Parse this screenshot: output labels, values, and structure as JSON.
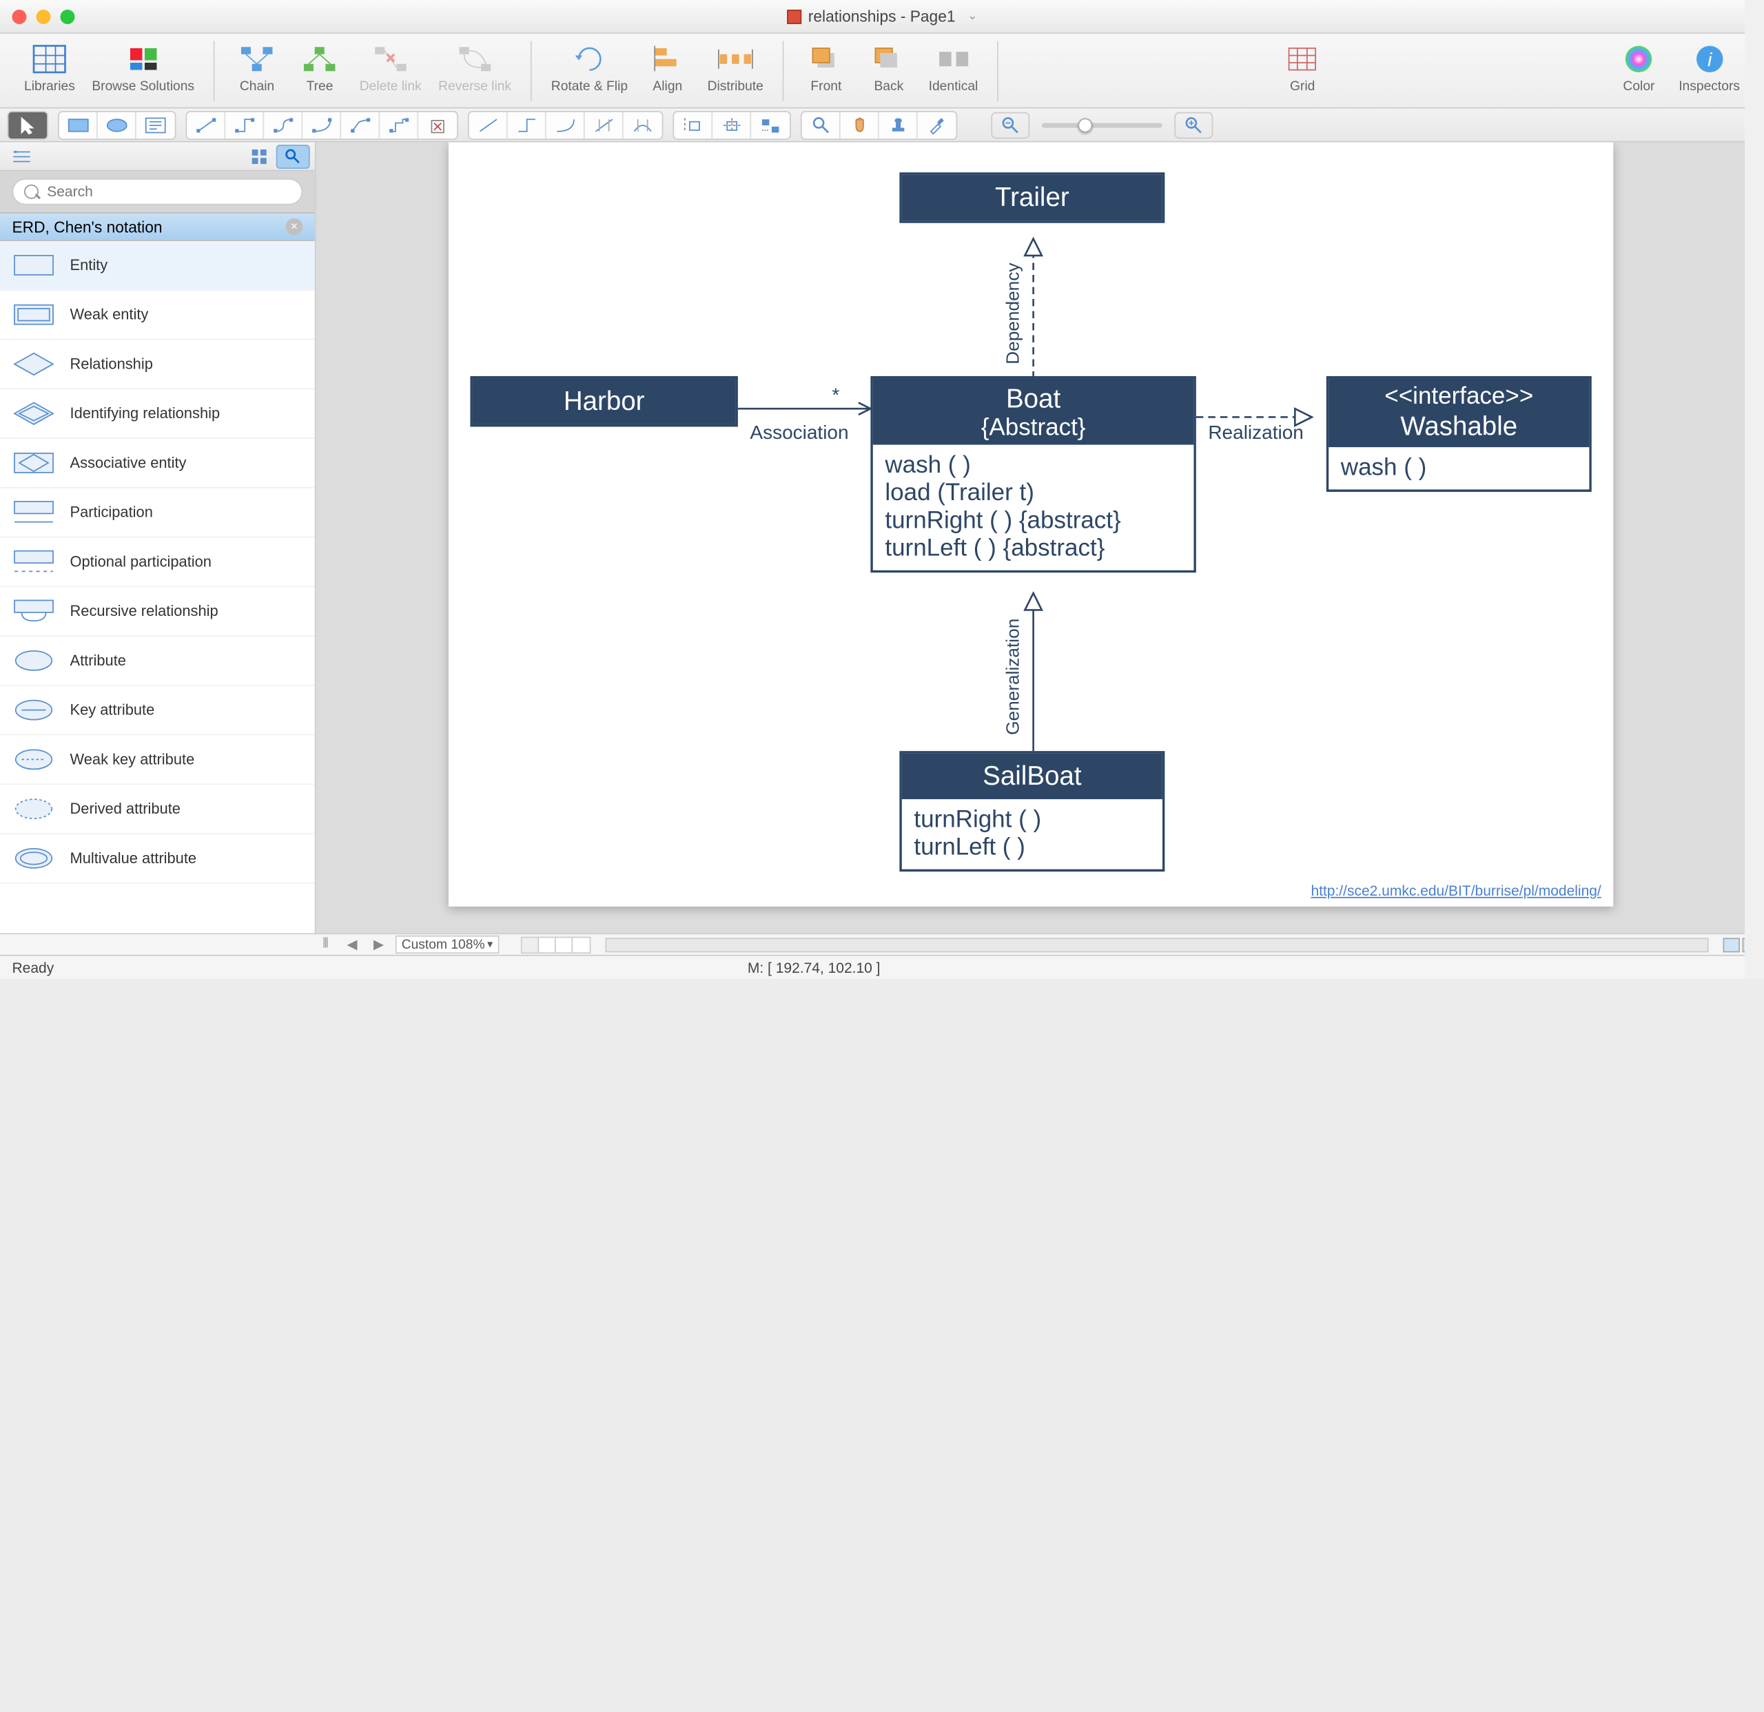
{
  "window": {
    "title": "relationships - Page1"
  },
  "toolbar": {
    "libraries": "Libraries",
    "browse": "Browse Solutions",
    "chain": "Chain",
    "tree": "Tree",
    "delete_link": "Delete link",
    "reverse_link": "Reverse link",
    "rotate_flip": "Rotate & Flip",
    "align": "Align",
    "distribute": "Distribute",
    "front": "Front",
    "back": "Back",
    "identical": "Identical",
    "grid": "Grid",
    "color": "Color",
    "inspectors": "Inspectors"
  },
  "sidebar": {
    "search_placeholder": "Search",
    "header": "ERD, Chen's notation",
    "items": [
      {
        "label": "Entity"
      },
      {
        "label": "Weak entity"
      },
      {
        "label": "Relationship"
      },
      {
        "label": "Identifying relationship"
      },
      {
        "label": "Associative entity"
      },
      {
        "label": "Participation"
      },
      {
        "label": "Optional participation"
      },
      {
        "label": "Recursive relationship"
      },
      {
        "label": "Attribute"
      },
      {
        "label": "Key attribute"
      },
      {
        "label": "Weak key attribute"
      },
      {
        "label": "Derived attribute"
      },
      {
        "label": "Multivalue attribute"
      }
    ]
  },
  "diagram": {
    "trailer": "Trailer",
    "harbor": "Harbor",
    "boat_title": "Boat",
    "boat_sub": "{Abstract}",
    "boat_ops": [
      "wash ( )",
      "load (Trailer t)",
      "turnRight ( ) {abstract}",
      "turnLeft ( ) {abstract}"
    ],
    "interface_stereo": "<<interface>>",
    "interface_name": "Washable",
    "interface_ops": [
      "wash ( )"
    ],
    "sailboat": "SailBoat",
    "sailboat_ops": [
      "turnRight ( )",
      "turnLeft ( )"
    ],
    "assoc": "Association",
    "mult": "*",
    "realization": "Realization",
    "dependency": "Dependency",
    "generalization": "Generalization",
    "link": "http://sce2.umkc.edu/BIT/burrise/pl/modeling/"
  },
  "pagebar": {
    "zoom": "Custom 108%"
  },
  "status": {
    "left": "Ready",
    "mid": "M: [ 192.74, 102.10 ]"
  }
}
